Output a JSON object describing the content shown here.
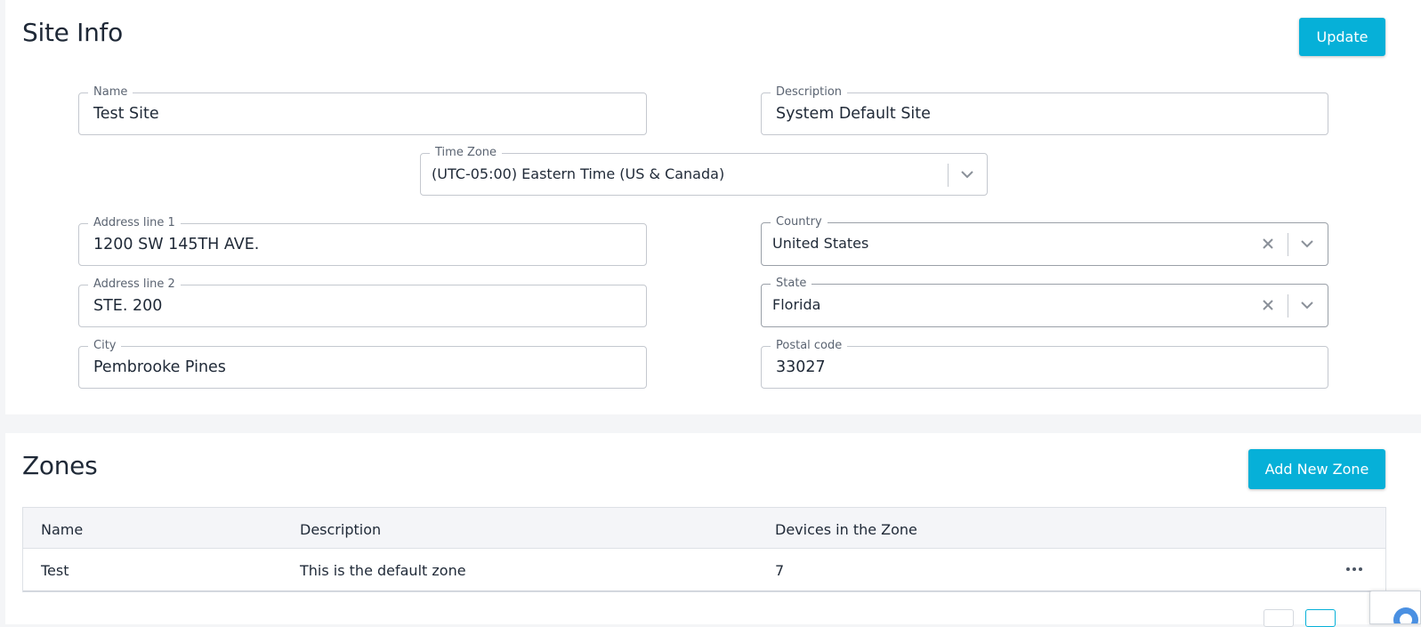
{
  "site": {
    "title": "Site Info",
    "update_label": "Update",
    "fields": {
      "name": {
        "label": "Name",
        "value": "Test Site"
      },
      "description": {
        "label": "Description",
        "value": "System Default Site"
      },
      "timezone": {
        "label": "Time Zone",
        "value": "(UTC-05:00) Eastern Time (US & Canada)"
      },
      "address1": {
        "label": "Address line 1",
        "value": "1200 SW 145TH AVE."
      },
      "country": {
        "label": "Country",
        "value": "United States"
      },
      "address2": {
        "label": "Address line 2",
        "value": "STE. 200"
      },
      "state": {
        "label": "State",
        "value": "Florida"
      },
      "city": {
        "label": "City",
        "value": "Pembrooke Pines"
      },
      "postal": {
        "label": "Postal code",
        "value": "33027"
      }
    }
  },
  "zones": {
    "title": "Zones",
    "add_label": "Add New Zone",
    "columns": [
      "Name",
      "Description",
      "Devices in the Zone"
    ],
    "rows": [
      {
        "name": "Test",
        "description": "This is the default zone",
        "devices": "7"
      }
    ]
  },
  "icons": {
    "chevron": "chevron-down-icon",
    "clear": "close-icon",
    "more": "more-horizontal-icon"
  },
  "colors": {
    "accent": "#06b0d8",
    "background": "#f4f5f7",
    "border": "#c4c8cf"
  }
}
